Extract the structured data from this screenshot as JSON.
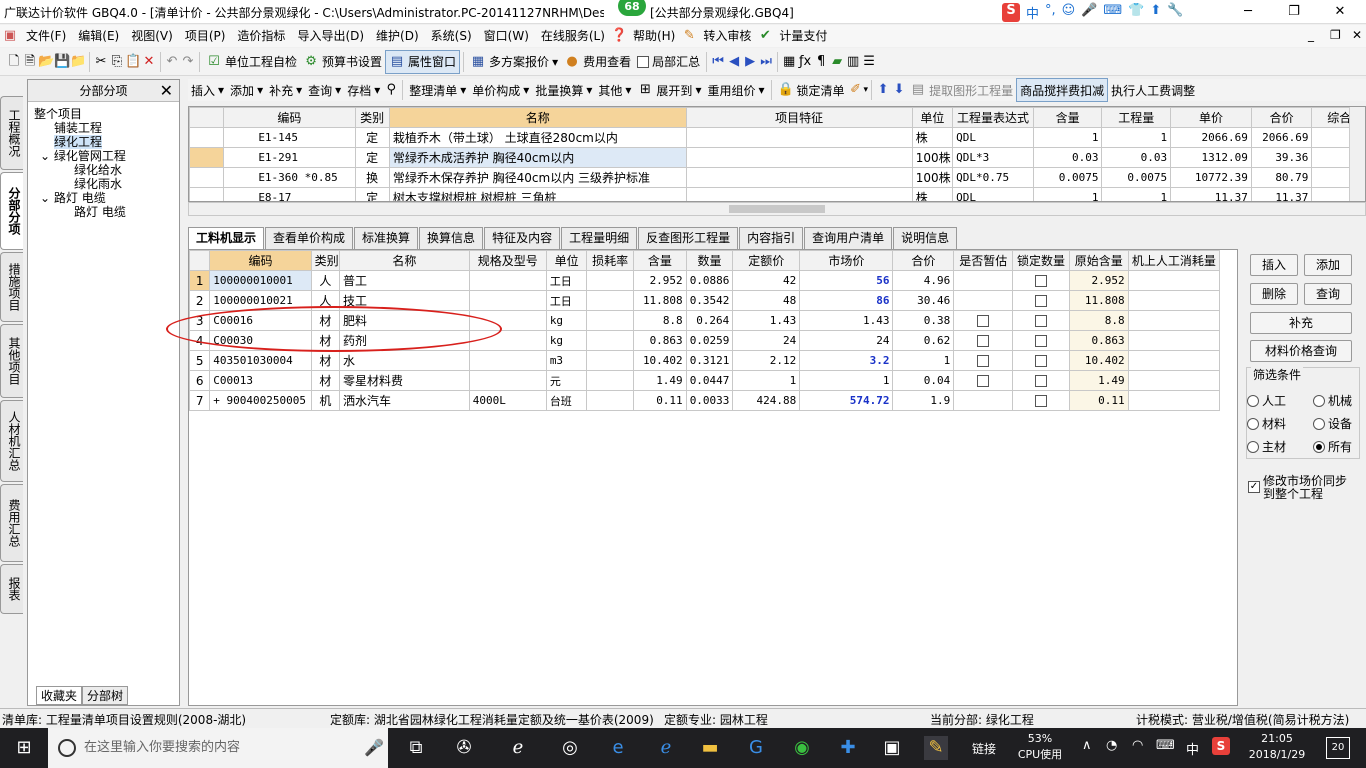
{
  "window": {
    "title_left": "广联达计价软件 GBQ4.0 - [清单计价 - 公共部分景观绿化 - C:\\Users\\Administrator.PC-20141127NRHM\\Des",
    "title_right": "[公共部分景观绿化.GBQ4]",
    "badge": "68",
    "ime": [
      "中",
      "°,",
      "☺",
      "🎤",
      "⌨",
      "👕",
      "⬆",
      "🔧"
    ]
  },
  "menu": [
    "文件(F)",
    "编辑(E)",
    "视图(V)",
    "项目(P)",
    "造价指标",
    "导入导出(D)",
    "维护(D)",
    "系统(S)",
    "窗口(W)",
    "在线服务(L)",
    "帮助(H)",
    "转入审核",
    "计量支付"
  ],
  "toolbar1": {
    "unit_check": "单位工程自检",
    "budget_setting": "预算书设置",
    "property_window": "属性窗口",
    "multi_plan": "多方案报价",
    "fee_view": "费用查看",
    "local_summary": "局部汇总"
  },
  "vtabs": [
    "工程概况",
    "分部分项",
    "措施项目",
    "其他项目",
    "人材机汇总",
    "费用汇总",
    "报表"
  ],
  "tree": {
    "header": "分部分项",
    "nodes": [
      "整个项目",
      "铺装工程",
      "绿化工程",
      "绿化管网工程",
      "绿化给水",
      "绿化雨水",
      "路灯 电缆",
      "路灯 电缆"
    ],
    "tabs": [
      "收藏夹",
      "分部树"
    ]
  },
  "toolbar2": [
    "插入",
    "添加",
    "补充",
    "查询",
    "存档",
    "整理清单",
    "单价构成",
    "批量换算",
    "其他",
    "展开到",
    "重用组价",
    "锁定清单",
    "提取图形工程量",
    "商品搅拌费扣减",
    "执行人工费调整"
  ],
  "grid1": {
    "headers": [
      "编码",
      "类别",
      "名称",
      "项目特征",
      "单位",
      "工程量表达式",
      "含量",
      "工程量",
      "单价",
      "合价",
      "综合"
    ],
    "rows": [
      {
        "code": "E1-145",
        "type": "定",
        "name": "栽植乔木（带土球） 土球直径280cm以内",
        "feature": "",
        "unit": "株",
        "expr": "QDL",
        "content": "1",
        "qty": "1",
        "price": "2066.69",
        "total": "2066.69"
      },
      {
        "code": "E1-291",
        "type": "定",
        "name": "常绿乔木成活养护 胸径40cm以内",
        "feature": "",
        "unit": "100株",
        "expr": "QDL*3",
        "content": "0.03",
        "qty": "0.03",
        "price": "1312.09",
        "total": "39.36"
      },
      {
        "code": "E1-360 *0.85",
        "type": "换",
        "name": "常绿乔木保存养护 胸径40cm以内 三级养护标准",
        "feature": "",
        "unit": "100株",
        "expr": "QDL*0.75",
        "content": "0.0075",
        "qty": "0.0075",
        "price": "10772.39",
        "total": "80.79"
      },
      {
        "code": "E8-17",
        "type": "定",
        "name": "树木支撑树棍桩 树棍桩 三角桩",
        "feature": "",
        "unit": "株",
        "expr": "QDL",
        "content": "1",
        "qty": "1",
        "price": "11.37",
        "total": "11.37"
      }
    ]
  },
  "btabs": [
    "工料机显示",
    "查看单价构成",
    "标准换算",
    "换算信息",
    "特征及内容",
    "工程量明细",
    "反查图形工程量",
    "内容指引",
    "查询用户清单",
    "说明信息"
  ],
  "grid2": {
    "headers": [
      "编码",
      "类别",
      "名称",
      "规格及型号",
      "单位",
      "损耗率",
      "含量",
      "数量",
      "定额价",
      "市场价",
      "合价",
      "是否暂估",
      "锁定数量",
      "原始含量",
      "机上人工消耗量"
    ],
    "rows": [
      {
        "no": "1",
        "code": "100000010001",
        "type": "人",
        "name": "普工",
        "spec": "",
        "unit": "工日",
        "loss": "",
        "content": "2.952",
        "qty": "0.0886",
        "base": "42",
        "market": "56",
        "total": "4.96",
        "est": false,
        "lock": true,
        "orig": "2.952"
      },
      {
        "no": "2",
        "code": "100000010021",
        "type": "人",
        "name": "技工",
        "spec": "",
        "unit": "工日",
        "loss": "",
        "content": "11.808",
        "qty": "0.3542",
        "base": "48",
        "market": "86",
        "total": "30.46",
        "est": false,
        "lock": true,
        "orig": "11.808"
      },
      {
        "no": "3",
        "code": "C00016",
        "type": "材",
        "name": "肥料",
        "spec": "",
        "unit": "kg",
        "loss": "",
        "content": "8.8",
        "qty": "0.264",
        "base": "1.43",
        "market": "1.43",
        "total": "0.38",
        "est": true,
        "lock": true,
        "orig": "8.8"
      },
      {
        "no": "4",
        "code": "C00030",
        "type": "材",
        "name": "药剂",
        "spec": "",
        "unit": "kg",
        "loss": "",
        "content": "0.863",
        "qty": "0.0259",
        "base": "24",
        "market": "24",
        "total": "0.62",
        "est": true,
        "lock": true,
        "orig": "0.863"
      },
      {
        "no": "5",
        "code": "403501030004",
        "type": "材",
        "name": "水",
        "spec": "",
        "unit": "m3",
        "loss": "",
        "content": "10.402",
        "qty": "0.3121",
        "base": "2.12",
        "market": "3.2",
        "total": "1",
        "est": true,
        "lock": true,
        "orig": "10.402"
      },
      {
        "no": "6",
        "code": "C00013",
        "type": "材",
        "name": "零星材料费",
        "spec": "",
        "unit": "元",
        "loss": "",
        "content": "1.49",
        "qty": "0.0447",
        "base": "1",
        "market": "1",
        "total": "0.04",
        "est": true,
        "lock": true,
        "orig": "1.49"
      },
      {
        "no": "7",
        "code": "900400250005",
        "type": "机",
        "name": "洒水汽车",
        "spec": "4000L",
        "unit": "台班",
        "loss": "",
        "content": "0.11",
        "qty": "0.0033",
        "base": "424.88",
        "market": "574.72",
        "total": "1.9",
        "est": false,
        "lock": true,
        "orig": "0.11"
      }
    ]
  },
  "side": {
    "insert": "插入",
    "add": "添加",
    "delete": "删除",
    "query": "查询",
    "supplement": "补充",
    "price_query": "材料价格查询",
    "filter_label": "筛选条件",
    "radios": [
      "人工",
      "机械",
      "材料",
      "设备",
      "主材",
      "所有"
    ],
    "sync_line1": "修改市场价同步",
    "sync_line2": "到整个工程"
  },
  "status": {
    "list_lib": "清单库:  工程量清单项目设置规则(2008-湖北)",
    "quota_lib": "定额库:  湖北省园林绿化工程消耗量定额及统一基价表(2009)",
    "quota_major": "定额专业:  园林工程",
    "current": "当前分部:  绿化工程",
    "tax": "计税模式:  营业税/增值税(简易计税方法)"
  },
  "taskbar": {
    "search_placeholder": "在这里输入你要搜索的内容",
    "link": "链接",
    "cpu_pct": "53%",
    "cpu_label": "CPU使用",
    "lang": "中",
    "time": "21:05",
    "date": "2018/1/29",
    "notif": "20"
  }
}
